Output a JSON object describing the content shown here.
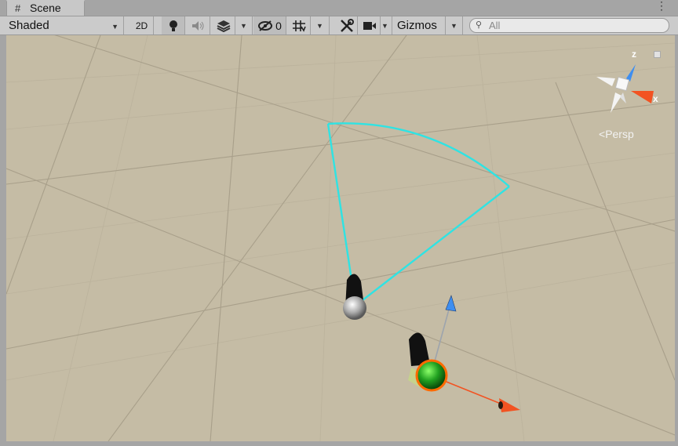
{
  "tab": {
    "icon": "grid-hash-icon",
    "title": "Scene"
  },
  "window_menu_icon": "kebab-menu-icon",
  "toolbar": {
    "draw_mode": "Shaded",
    "twod_label": "2D",
    "lighting_icon": "lightbulb-icon",
    "audio_icon": "speaker-icon",
    "effects_icon": "layers-icon",
    "visibility_icon": "hidden-eye-icon",
    "hidden_count": "0",
    "grid_icon": "grid-snap-icon",
    "tools_icon": "tools-icon",
    "camera_icon": "camera-icon",
    "gizmos_label": "Gizmos",
    "search_placeholder": "All"
  },
  "gizmo": {
    "z_label": "z",
    "x_label": "x",
    "projection_label": "Persp",
    "lock_icon": "lock-icon"
  },
  "colors": {
    "viewport": "#c5bca5",
    "grid_line": "#a89f8a",
    "fov_cyan": "#2fe3e3",
    "axis_x": "#f25322",
    "axis_y": "#8fd14a",
    "axis_z": "#3e8ef0",
    "selection_orange": "#ff6a00",
    "green_object": "#1f9a1f"
  }
}
